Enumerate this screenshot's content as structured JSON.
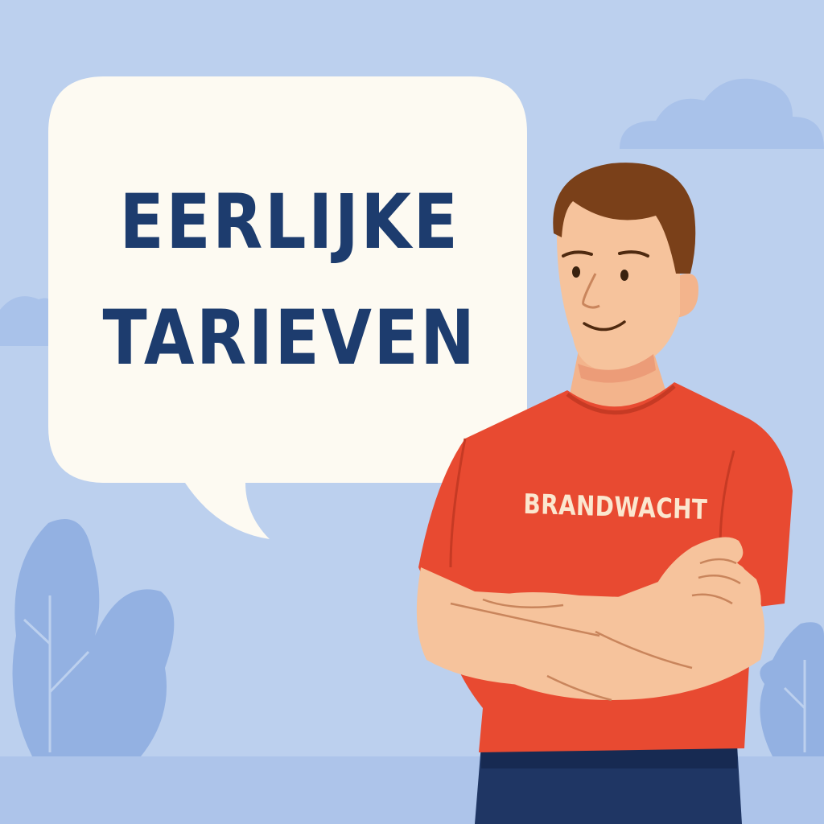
{
  "speech_bubble": {
    "line1": "EERLIJKE",
    "line2": "TARIEVEN"
  },
  "shirt": {
    "label": "BRANDWACHT"
  },
  "colors": {
    "sky": "#bcd0ee",
    "bubble": "#fdfaf2",
    "bubble_text": "#1d3c6e",
    "shirt": "#e84a31",
    "shirt_text": "#fbe7cf",
    "skin": "#f6c39c",
    "hair": "#7a4019",
    "pants": "#1f3664",
    "foliage": "#93b1e2"
  }
}
